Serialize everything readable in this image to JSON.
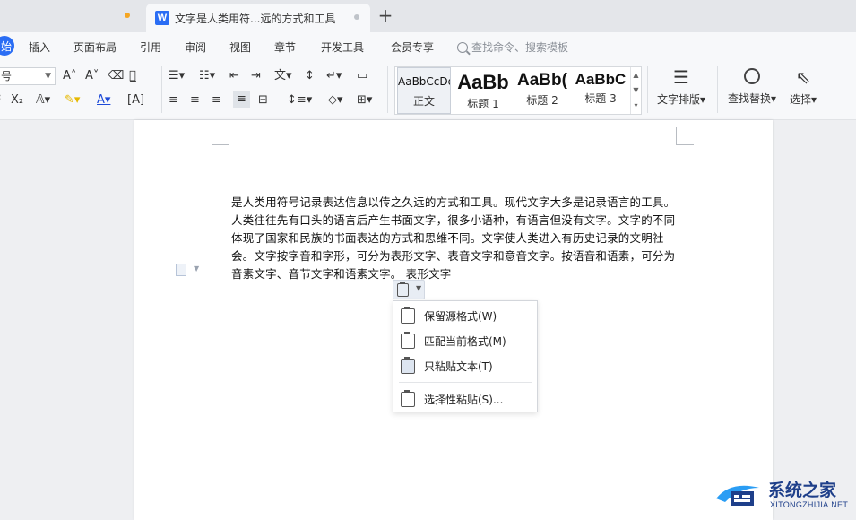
{
  "titlebar": {
    "tab_title": "文字是人类用符...远的方式和工具",
    "app_logo": "W",
    "new_tab_label": "+"
  },
  "menubar": {
    "active_label": "始",
    "items": [
      "插入",
      "页面布局",
      "引用",
      "审阅",
      "视图",
      "章节",
      "开发工具",
      "会员专享"
    ],
    "search_placeholder": "查找命令、搜索模板"
  },
  "ribbon": {
    "font_size_value": "号",
    "style_presets": [
      {
        "sample": "AaBbCcDd",
        "name": "正文"
      },
      {
        "sample": "AaBb",
        "name": "标题 1"
      },
      {
        "sample": "AaBb(",
        "name": "标题 2"
      },
      {
        "sample": "AaBbC",
        "name": "标题 3"
      }
    ],
    "text_layout_label": "文字排版",
    "find_replace_label": "查找替换",
    "select_label": "选择",
    "icons": [
      "increase-font-icon",
      "decrease-font-icon",
      "clear-format-icon",
      "phonetic-icon",
      "bullets-icon",
      "numbering-icon",
      "indent-icon",
      "outdent-icon",
      "superscript-icon",
      "subscript-icon",
      "font-color-icon",
      "highlight-icon",
      "align-left-icon",
      "align-center-icon",
      "align-right-icon",
      "justify-icon",
      "line-spacing-icon",
      "shading-icon",
      "border-icon"
    ]
  },
  "document": {
    "paragraph": "是人类用符号记录表达信息以传之久远的方式和工具。现代文字大多是记录语言的工具。人类往往先有口头的语言后产生书面文字，很多小语种，有语言但没有文字。文字的不同体现了国家和民族的书面表达的方式和思维不同。文字使人类进入有历史记录的文明社会。文字按字音和字形，可分为表形文字、表音文字和意音文字。按语音和语素，可分为音素文字、音节文字和语素文字。  表形文字"
  },
  "paste_menu": {
    "items": [
      {
        "label": "保留源格式(W)"
      },
      {
        "label": "匹配当前格式(M)"
      },
      {
        "label": "只粘贴文本(T)"
      },
      {
        "label": "选择性粘贴(S)..."
      }
    ]
  },
  "watermark": {
    "main": "系统之家",
    "sub": "XITONGZHIJIA.NET"
  },
  "colors": {
    "accent": "#2a6df4",
    "watermark": "#1e3f8a"
  }
}
